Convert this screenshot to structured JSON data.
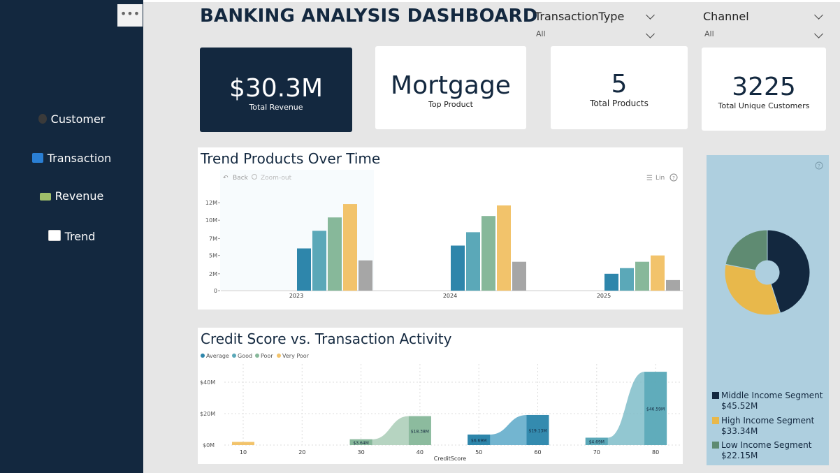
{
  "sidebar": {
    "more_label": "•••",
    "items": [
      {
        "label": "Customer",
        "icon": "person-icon"
      },
      {
        "label": "Transaction",
        "icon": "repeat-icon"
      },
      {
        "label": "Revenue",
        "icon": "money-icon"
      },
      {
        "label": "Trend",
        "icon": "chart-up-icon"
      }
    ]
  },
  "title": "BANKING ANALYSIS DASHBOARD",
  "slicers": [
    {
      "label": "TransactionType",
      "value": "All"
    },
    {
      "label": "Channel",
      "value": "All"
    }
  ],
  "kpis": [
    {
      "value": "$30.3M",
      "label": "Total Revenue"
    },
    {
      "value": "Mortgage",
      "label": "Top Product"
    },
    {
      "value": "5",
      "label": "Total  Products"
    },
    {
      "value": "3225",
      "label": "Total Unique Customers"
    }
  ],
  "colors": {
    "navy": "#13283f",
    "s1": "#2e86ab",
    "s2": "#5ba8b8",
    "s3": "#87b89a",
    "s4": "#f2c36b",
    "s5": "#a6a6a6"
  },
  "trend_chart": {
    "toolbar": {
      "back": "Back",
      "zoom": "Zoom-out",
      "lin": "Lin",
      "help": "?"
    }
  },
  "credit_chart": {
    "legend": [
      "Average",
      "Good",
      "Poor",
      "Very Poor"
    ],
    "y_ticks": [
      "$40M",
      "$20M",
      "$0M"
    ],
    "x_ticks": [
      "10",
      "20",
      "30",
      "40",
      "50",
      "60",
      "70",
      "80"
    ],
    "x_title": "CreditScore",
    "labels": [
      "$3.64M",
      "$18.38M",
      "$6.69M",
      "$19.13M",
      "$4.69M",
      "$46.59M"
    ]
  },
  "donut": {
    "help": "?",
    "segments": [
      {
        "name": "Middle Income Segment",
        "value": "$45.52M"
      },
      {
        "name": "High Income Segment",
        "value": "$33.34M"
      },
      {
        "name": "Low Income Segment",
        "value": "$22.15M"
      }
    ]
  },
  "chart_data": [
    {
      "type": "bar",
      "title": "Trend Products Over Time",
      "categories": [
        "2023",
        "2024",
        "2025"
      ],
      "y_ticks": [
        "0",
        "2M",
        "5M",
        "7M",
        "10M",
        "12M"
      ],
      "ylim": [
        0,
        13
      ],
      "series": [
        {
          "values": [
            6.0,
            6.4,
            2.4
          ]
        },
        {
          "values": [
            8.5,
            8.3,
            3.2
          ]
        },
        {
          "values": [
            10.4,
            10.6,
            4.1
          ]
        },
        {
          "values": [
            12.3,
            12.1,
            5.0
          ]
        },
        {
          "values": [
            4.3,
            4.1,
            1.5
          ]
        }
      ]
    },
    {
      "type": "bar",
      "title": "Credit Score vs. Transaction Activity",
      "xlabel": "CreditScore",
      "ylim": [
        0,
        50
      ],
      "points": [
        {
          "x": 10,
          "y": 2.0
        },
        {
          "x": 30,
          "y": 3.64
        },
        {
          "x": 40,
          "y": 18.38
        },
        {
          "x": 50,
          "y": 6.69
        },
        {
          "x": 60,
          "y": 19.13
        },
        {
          "x": 70,
          "y": 4.69
        },
        {
          "x": 80,
          "y": 46.59
        }
      ]
    },
    {
      "type": "pie",
      "slices": [
        {
          "label": "Middle Income Segment",
          "value": 45.52
        },
        {
          "label": "High Income Segment",
          "value": 33.34
        },
        {
          "label": "Low Income Segment",
          "value": 22.15
        }
      ]
    }
  ]
}
